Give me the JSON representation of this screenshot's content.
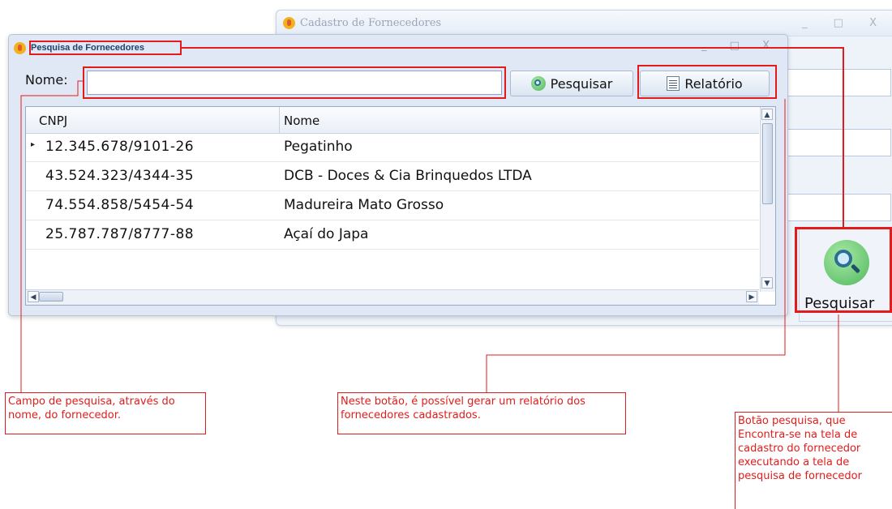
{
  "background_window": {
    "title": "Cadastro de Fornecedores",
    "controls": "_ □ X",
    "search_button_label": "Pesquisar"
  },
  "dialog": {
    "title": "Pesquisa de Fornecedores",
    "controls": "_ □ X",
    "nome_label": "Nome:",
    "nome_value": "",
    "pesquisar_label": "Pesquisar",
    "relatorio_label": "Relatório"
  },
  "grid": {
    "columns": [
      "CNPJ",
      "Nome"
    ],
    "rows": [
      {
        "cnpj": "12.345.678/9101-26",
        "nome": "Pegatinho"
      },
      {
        "cnpj": "43.524.323/4344-35",
        "nome": "DCB - Doces & Cia Brinquedos LTDA"
      },
      {
        "cnpj": "74.554.858/5454-54",
        "nome": "Madureira Mato Grosso"
      },
      {
        "cnpj": "25.787.787/8777-88",
        "nome": "Açaí do Japa"
      }
    ],
    "selected_row_indicator": "▸"
  },
  "annotations": {
    "search_field": "Campo de pesquisa, através do nome, do fornecedor.",
    "report_button": "Neste botão, é possível gerar um relatório dos fornecedores cadastrados.",
    "search_button": "Botão pesquisa, que Encontra-se na tela de cadastro do fornecedor executando a tela de pesquisa de fornecedor"
  },
  "colors": {
    "annotation": "#e21b1b",
    "dialog_title": "#21406b"
  }
}
